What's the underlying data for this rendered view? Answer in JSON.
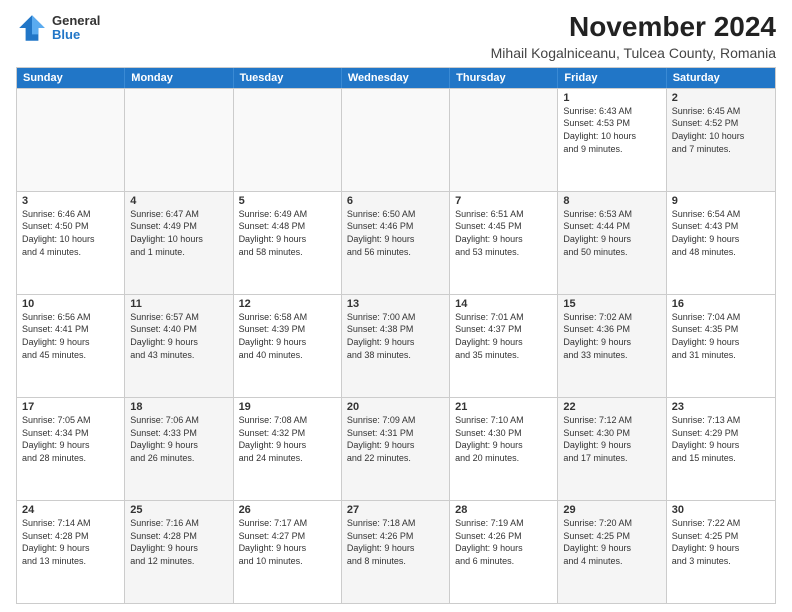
{
  "logo": {
    "general": "General",
    "blue": "Blue"
  },
  "title": "November 2024",
  "subtitle": "Mihail Kogalniceanu, Tulcea County, Romania",
  "columns": [
    "Sunday",
    "Monday",
    "Tuesday",
    "Wednesday",
    "Thursday",
    "Friday",
    "Saturday"
  ],
  "weeks": [
    [
      {
        "day": "",
        "info": "",
        "empty": true
      },
      {
        "day": "",
        "info": "",
        "empty": true
      },
      {
        "day": "",
        "info": "",
        "empty": true
      },
      {
        "day": "",
        "info": "",
        "empty": true
      },
      {
        "day": "",
        "info": "",
        "empty": true
      },
      {
        "day": "1",
        "info": "Sunrise: 6:43 AM\nSunset: 4:53 PM\nDaylight: 10 hours\nand 9 minutes.",
        "empty": false
      },
      {
        "day": "2",
        "info": "Sunrise: 6:45 AM\nSunset: 4:52 PM\nDaylight: 10 hours\nand 7 minutes.",
        "empty": false,
        "shaded": true
      }
    ],
    [
      {
        "day": "3",
        "info": "Sunrise: 6:46 AM\nSunset: 4:50 PM\nDaylight: 10 hours\nand 4 minutes.",
        "empty": false
      },
      {
        "day": "4",
        "info": "Sunrise: 6:47 AM\nSunset: 4:49 PM\nDaylight: 10 hours\nand 1 minute.",
        "empty": false,
        "shaded": true
      },
      {
        "day": "5",
        "info": "Sunrise: 6:49 AM\nSunset: 4:48 PM\nDaylight: 9 hours\nand 58 minutes.",
        "empty": false
      },
      {
        "day": "6",
        "info": "Sunrise: 6:50 AM\nSunset: 4:46 PM\nDaylight: 9 hours\nand 56 minutes.",
        "empty": false,
        "shaded": true
      },
      {
        "day": "7",
        "info": "Sunrise: 6:51 AM\nSunset: 4:45 PM\nDaylight: 9 hours\nand 53 minutes.",
        "empty": false
      },
      {
        "day": "8",
        "info": "Sunrise: 6:53 AM\nSunset: 4:44 PM\nDaylight: 9 hours\nand 50 minutes.",
        "empty": false,
        "shaded": true
      },
      {
        "day": "9",
        "info": "Sunrise: 6:54 AM\nSunset: 4:43 PM\nDaylight: 9 hours\nand 48 minutes.",
        "empty": false
      }
    ],
    [
      {
        "day": "10",
        "info": "Sunrise: 6:56 AM\nSunset: 4:41 PM\nDaylight: 9 hours\nand 45 minutes.",
        "empty": false
      },
      {
        "day": "11",
        "info": "Sunrise: 6:57 AM\nSunset: 4:40 PM\nDaylight: 9 hours\nand 43 minutes.",
        "empty": false,
        "shaded": true
      },
      {
        "day": "12",
        "info": "Sunrise: 6:58 AM\nSunset: 4:39 PM\nDaylight: 9 hours\nand 40 minutes.",
        "empty": false
      },
      {
        "day": "13",
        "info": "Sunrise: 7:00 AM\nSunset: 4:38 PM\nDaylight: 9 hours\nand 38 minutes.",
        "empty": false,
        "shaded": true
      },
      {
        "day": "14",
        "info": "Sunrise: 7:01 AM\nSunset: 4:37 PM\nDaylight: 9 hours\nand 35 minutes.",
        "empty": false
      },
      {
        "day": "15",
        "info": "Sunrise: 7:02 AM\nSunset: 4:36 PM\nDaylight: 9 hours\nand 33 minutes.",
        "empty": false,
        "shaded": true
      },
      {
        "day": "16",
        "info": "Sunrise: 7:04 AM\nSunset: 4:35 PM\nDaylight: 9 hours\nand 31 minutes.",
        "empty": false
      }
    ],
    [
      {
        "day": "17",
        "info": "Sunrise: 7:05 AM\nSunset: 4:34 PM\nDaylight: 9 hours\nand 28 minutes.",
        "empty": false
      },
      {
        "day": "18",
        "info": "Sunrise: 7:06 AM\nSunset: 4:33 PM\nDaylight: 9 hours\nand 26 minutes.",
        "empty": false,
        "shaded": true
      },
      {
        "day": "19",
        "info": "Sunrise: 7:08 AM\nSunset: 4:32 PM\nDaylight: 9 hours\nand 24 minutes.",
        "empty": false
      },
      {
        "day": "20",
        "info": "Sunrise: 7:09 AM\nSunset: 4:31 PM\nDaylight: 9 hours\nand 22 minutes.",
        "empty": false,
        "shaded": true
      },
      {
        "day": "21",
        "info": "Sunrise: 7:10 AM\nSunset: 4:30 PM\nDaylight: 9 hours\nand 20 minutes.",
        "empty": false
      },
      {
        "day": "22",
        "info": "Sunrise: 7:12 AM\nSunset: 4:30 PM\nDaylight: 9 hours\nand 17 minutes.",
        "empty": false,
        "shaded": true
      },
      {
        "day": "23",
        "info": "Sunrise: 7:13 AM\nSunset: 4:29 PM\nDaylight: 9 hours\nand 15 minutes.",
        "empty": false
      }
    ],
    [
      {
        "day": "24",
        "info": "Sunrise: 7:14 AM\nSunset: 4:28 PM\nDaylight: 9 hours\nand 13 minutes.",
        "empty": false
      },
      {
        "day": "25",
        "info": "Sunrise: 7:16 AM\nSunset: 4:28 PM\nDaylight: 9 hours\nand 12 minutes.",
        "empty": false,
        "shaded": true
      },
      {
        "day": "26",
        "info": "Sunrise: 7:17 AM\nSunset: 4:27 PM\nDaylight: 9 hours\nand 10 minutes.",
        "empty": false
      },
      {
        "day": "27",
        "info": "Sunrise: 7:18 AM\nSunset: 4:26 PM\nDaylight: 9 hours\nand 8 minutes.",
        "empty": false,
        "shaded": true
      },
      {
        "day": "28",
        "info": "Sunrise: 7:19 AM\nSunset: 4:26 PM\nDaylight: 9 hours\nand 6 minutes.",
        "empty": false
      },
      {
        "day": "29",
        "info": "Sunrise: 7:20 AM\nSunset: 4:25 PM\nDaylight: 9 hours\nand 4 minutes.",
        "empty": false,
        "shaded": true
      },
      {
        "day": "30",
        "info": "Sunrise: 7:22 AM\nSunset: 4:25 PM\nDaylight: 9 hours\nand 3 minutes.",
        "empty": false
      }
    ]
  ]
}
